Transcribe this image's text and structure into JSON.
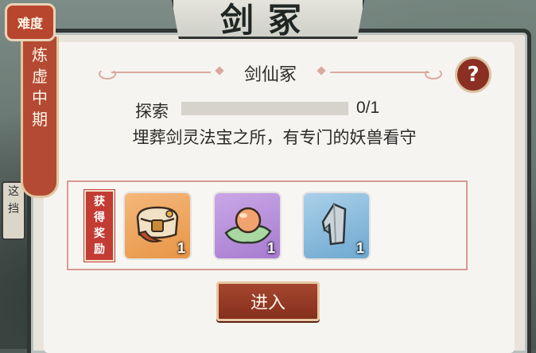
{
  "header": {
    "title": "剑冢"
  },
  "difficulty": {
    "badge": "难度",
    "level": "炼虚中期"
  },
  "background": {
    "left_tag": "这挡"
  },
  "panel": {
    "subtitle": "剑仙冢",
    "help_symbol": "?",
    "explore": {
      "label": "探索",
      "progress": 0,
      "count": "0/1"
    },
    "description": "埋葬剑灵法宝之所，有专门的妖兽看守"
  },
  "rewards": {
    "tag": "获得奖励",
    "items": [
      {
        "icon": "treasure-chest-icon",
        "quantity": "1",
        "rarity_color": "#e79646"
      },
      {
        "icon": "spirit-orb-icon",
        "quantity": "1",
        "rarity_color": "#a77bd0"
      },
      {
        "icon": "iron-ore-icon",
        "quantity": "1",
        "rarity_color": "#6ea8d0"
      }
    ]
  },
  "actions": {
    "enter_label": "进入"
  },
  "colors": {
    "accent": "#8b2f22",
    "badge": "#b8462f",
    "frame": "#2f3633"
  }
}
